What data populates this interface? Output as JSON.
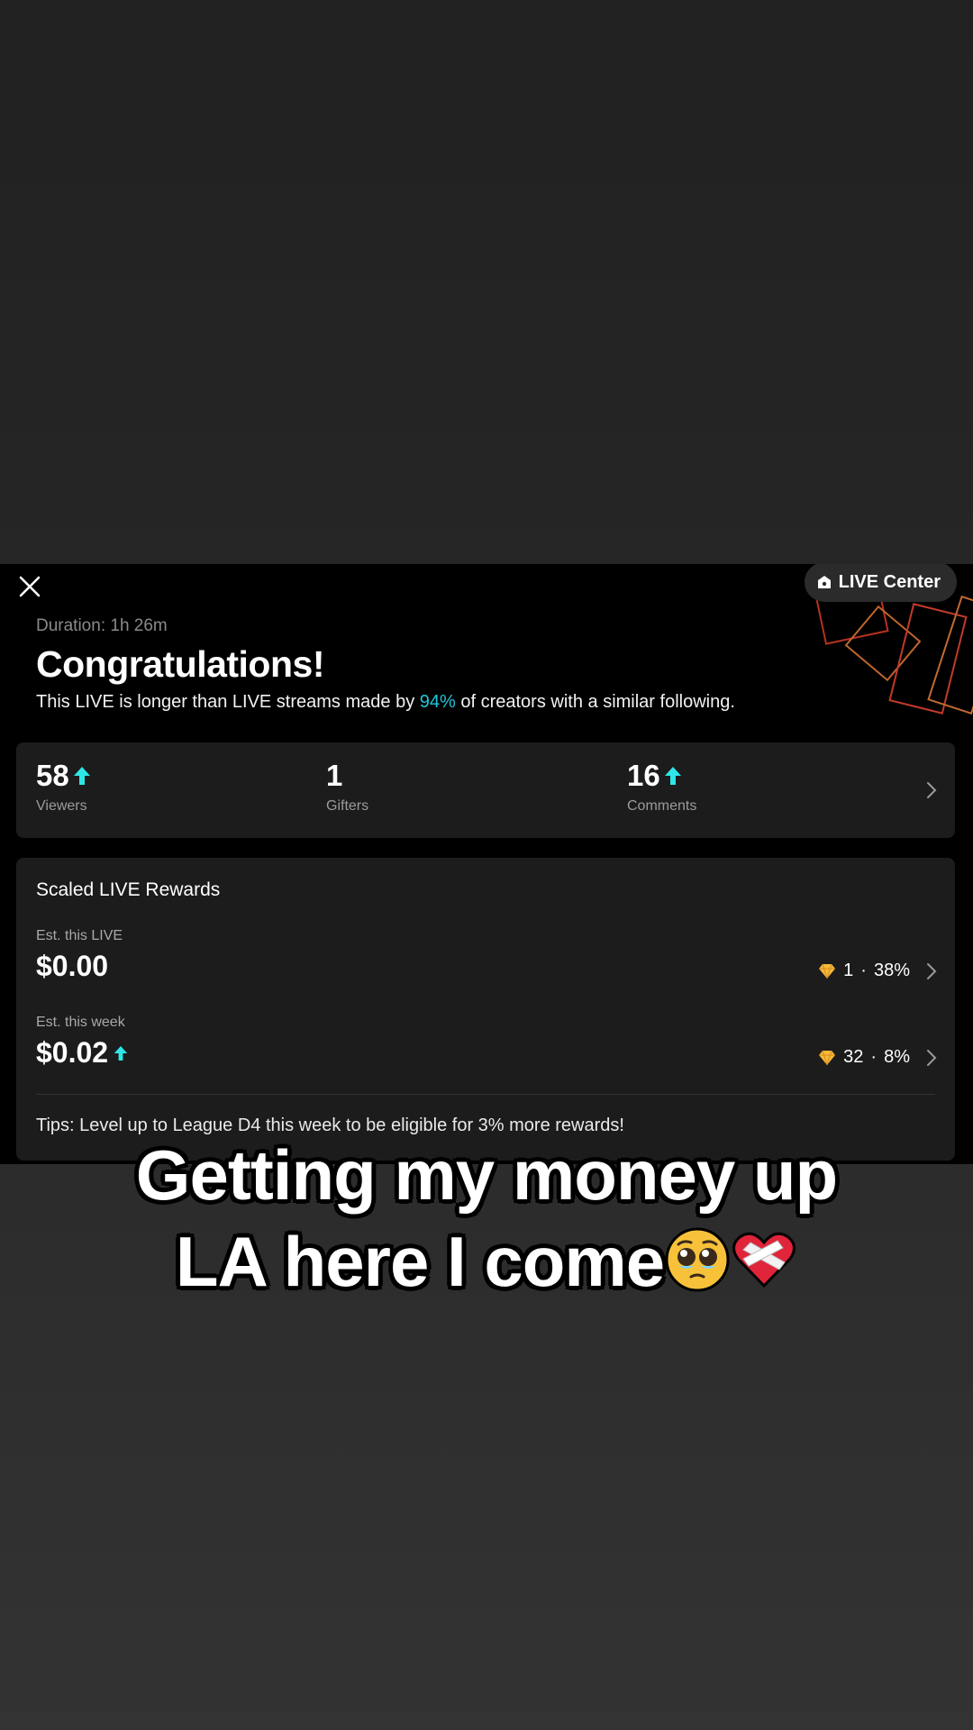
{
  "header": {
    "live_center_label": "LIVE Center",
    "duration": "Duration: 1h 26m",
    "title": "Congratulations!",
    "subline_before": "This LIVE is longer than LIVE streams made by ",
    "subline_highlight": "94%",
    "subline_after": " of creators with a similar following."
  },
  "stats": [
    {
      "value": "58",
      "label": "Viewers",
      "trend": "up"
    },
    {
      "value": "1",
      "label": "Gifters",
      "trend": "none"
    },
    {
      "value": "16",
      "label": "Comments",
      "trend": "up"
    }
  ],
  "rewards": {
    "title": "Scaled LIVE Rewards",
    "live_label": "Est. this LIVE",
    "live_amount": "$0.00",
    "live_gems": "1",
    "live_sep": "·",
    "live_percent": "38%",
    "week_label": "Est. this week",
    "week_amount": "$0.02",
    "week_trend": "up",
    "week_gems": "32",
    "week_sep": "·",
    "week_percent": "8%",
    "tips": "Tips: Level up to League D4 this week to be eligible for 3% more rewards!"
  },
  "caption": {
    "line1": "Getting my money up",
    "line2": "LA here I come"
  },
  "colors": {
    "accent": "#20c6d8",
    "panel": "#000000",
    "card": "#1c1c1c"
  },
  "icons": [
    "close-icon",
    "live-center-icon",
    "up-arrow-icon",
    "chevron-right-icon",
    "gem-icon",
    "pleading-face-emoji",
    "mending-heart-emoji"
  ]
}
